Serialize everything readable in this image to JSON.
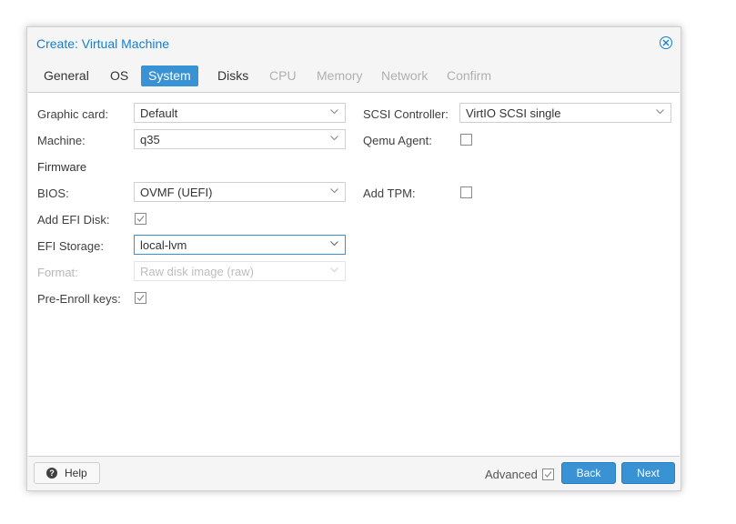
{
  "dialog": {
    "title": "Create: Virtual Machine"
  },
  "tabs": [
    {
      "label": "General",
      "state": "normal"
    },
    {
      "label": "OS",
      "state": "normal"
    },
    {
      "label": "System",
      "state": "active"
    },
    {
      "label": "Disks",
      "state": "normal"
    },
    {
      "label": "CPU",
      "state": "disabled"
    },
    {
      "label": "Memory",
      "state": "disabled"
    },
    {
      "label": "Network",
      "state": "disabled"
    },
    {
      "label": "Confirm",
      "state": "disabled"
    }
  ],
  "form": {
    "graphic_card": {
      "label": "Graphic card:",
      "value": "Default"
    },
    "machine": {
      "label": "Machine:",
      "value": "q35"
    },
    "firmware_heading": "Firmware",
    "bios": {
      "label": "BIOS:",
      "value": "OVMF (UEFI)"
    },
    "add_efi_disk": {
      "label": "Add EFI Disk:",
      "checked": true
    },
    "efi_storage": {
      "label": "EFI Storage:",
      "value": "local-lvm"
    },
    "format": {
      "label": "Format:",
      "value": "Raw disk image (raw)",
      "disabled": true
    },
    "pre_enroll_keys": {
      "label": "Pre-Enroll keys:",
      "checked": true
    },
    "scsi_controller": {
      "label": "SCSI Controller:",
      "value": "VirtIO SCSI single"
    },
    "qemu_agent": {
      "label": "Qemu Agent:",
      "checked": false
    },
    "add_tpm": {
      "label": "Add TPM:",
      "checked": false
    }
  },
  "footer": {
    "help_label": "Help",
    "advanced_label": "Advanced",
    "advanced_checked": true,
    "back_label": "Back",
    "next_label": "Next"
  },
  "colors": {
    "accent": "#3892d4",
    "title": "#157fcc",
    "disabled_text": "#b0b0b0"
  },
  "icons": {
    "close": "close-circle-icon",
    "help": "question-circle-icon",
    "dropdown": "chevron-down-icon",
    "checkbox": "checkmark-icon"
  }
}
